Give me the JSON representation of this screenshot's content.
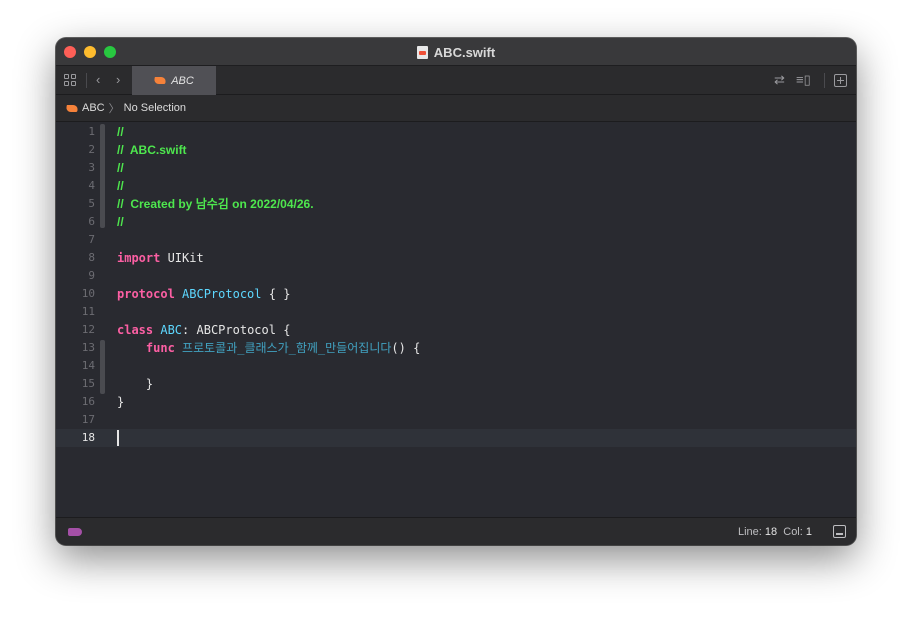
{
  "window": {
    "title": "ABC.swift"
  },
  "tabbar": {
    "active_tab": "ABC",
    "icons": [
      "grid-icon",
      "back-chevron-icon",
      "forward-chevron-icon",
      "swap-icon",
      "split-editor-icon",
      "add-editor-icon"
    ]
  },
  "jumpbar": {
    "file": "ABC",
    "chevron": "〉",
    "selection": "No Selection"
  },
  "editor": {
    "current_line": 18,
    "lines": [
      {
        "n": "1",
        "tokens": [
          {
            "t": "//",
            "c": "comment"
          }
        ]
      },
      {
        "n": "2",
        "tokens": [
          {
            "t": "//  ABC.swift",
            "c": "comment"
          }
        ]
      },
      {
        "n": "3",
        "tokens": [
          {
            "t": "//",
            "c": "comment"
          }
        ]
      },
      {
        "n": "4",
        "tokens": [
          {
            "t": "//",
            "c": "comment"
          }
        ]
      },
      {
        "n": "5",
        "tokens": [
          {
            "t": "//  Created by 남수김 on 2022/04/26.",
            "c": "comment"
          }
        ]
      },
      {
        "n": "6",
        "tokens": [
          {
            "t": "//",
            "c": "comment"
          }
        ]
      },
      {
        "n": "7",
        "tokens": []
      },
      {
        "n": "8",
        "tokens": [
          {
            "t": "import",
            "c": "kw"
          },
          {
            "t": " UIKit",
            "c": "pl"
          }
        ]
      },
      {
        "n": "9",
        "tokens": []
      },
      {
        "n": "10",
        "tokens": [
          {
            "t": "protocol",
            "c": "kw"
          },
          {
            "t": " ",
            "c": "pl"
          },
          {
            "t": "ABCProtocol",
            "c": "ty"
          },
          {
            "t": " { }",
            "c": "pl"
          }
        ]
      },
      {
        "n": "11",
        "tokens": []
      },
      {
        "n": "12",
        "tokens": [
          {
            "t": "class",
            "c": "kw"
          },
          {
            "t": " ",
            "c": "pl"
          },
          {
            "t": "ABC",
            "c": "ty"
          },
          {
            "t": ": ABCProtocol {",
            "c": "pl"
          }
        ]
      },
      {
        "n": "13",
        "tokens": [
          {
            "t": "    ",
            "c": "pl"
          },
          {
            "t": "func",
            "c": "kw"
          },
          {
            "t": " ",
            "c": "pl"
          },
          {
            "t": "프로토콜과_클래스가_함께_만들어집니다",
            "c": "fn"
          },
          {
            "t": "() {",
            "c": "pl"
          }
        ]
      },
      {
        "n": "14",
        "tokens": []
      },
      {
        "n": "15",
        "tokens": [
          {
            "t": "    }",
            "c": "pl"
          }
        ]
      },
      {
        "n": "16",
        "tokens": [
          {
            "t": "}",
            "c": "pl"
          }
        ]
      },
      {
        "n": "17",
        "tokens": []
      },
      {
        "n": "18",
        "tokens": []
      }
    ]
  },
  "statusbar": {
    "line_label": "Line:",
    "line_value": "18",
    "col_label": "Col:",
    "col_value": "1"
  },
  "colors": {
    "comment": "#4ee74e",
    "keyword": "#fc5fa3",
    "type": "#5dd8ff",
    "function": "#41a1c0",
    "background": "#292a30"
  }
}
